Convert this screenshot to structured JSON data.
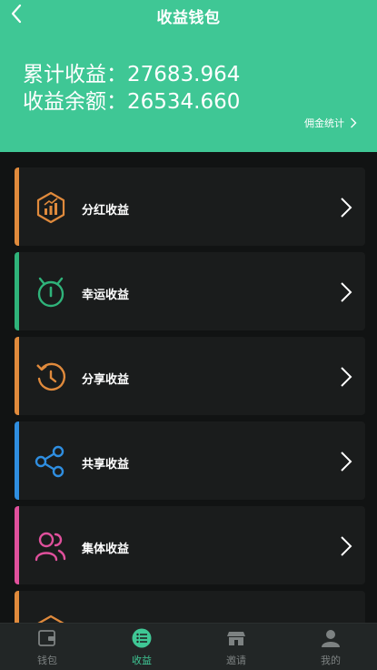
{
  "header": {
    "title": "收益钱包",
    "total_income": "累计收益：27683.964",
    "balance": "收益余额：26534.660",
    "commission_link": "佣金统计"
  },
  "items": [
    {
      "label": "分红收益",
      "accent": "#e08a3c",
      "icon": "dividend-icon"
    },
    {
      "label": "幸运收益",
      "accent": "#2fb37a",
      "icon": "timer-icon"
    },
    {
      "label": "分享收益",
      "accent": "#e08a3c",
      "icon": "refresh-clock-icon"
    },
    {
      "label": "共享收益",
      "accent": "#2f8ee0",
      "icon": "share-icon"
    },
    {
      "label": "集体收益",
      "accent": "#e0509c",
      "icon": "group-icon"
    },
    {
      "label": "",
      "accent": "#e08a3c",
      "icon": "partial-icon"
    }
  ],
  "tabs": [
    {
      "label": "钱包",
      "icon": "wallet-icon",
      "active": false
    },
    {
      "label": "收益",
      "icon": "list-icon",
      "active": true
    },
    {
      "label": "邀请",
      "icon": "store-icon",
      "active": false
    },
    {
      "label": "我的",
      "icon": "user-icon",
      "active": false
    }
  ],
  "colors": {
    "primary": "#3fc795",
    "background": "#111313",
    "card": "#1a1c1c",
    "tabbar": "#222626"
  }
}
